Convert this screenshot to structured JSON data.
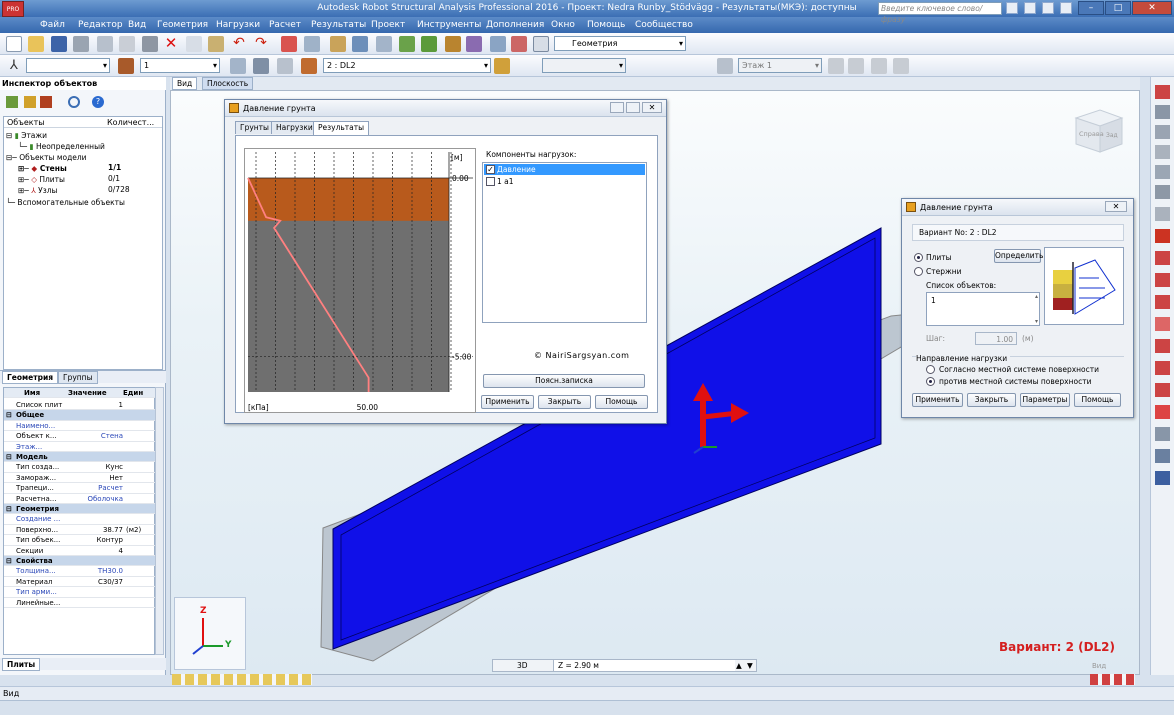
{
  "window": {
    "title": "Autodesk Robot Structural Analysis Professional 2016 - Проект: Nedra Runby_Stödvägg - Результаты(МКЭ): доступны",
    "app_badge": "PRO"
  },
  "menu": [
    "Файл",
    "Редактор",
    "Вид",
    "Геометрия",
    "Нагрузки",
    "Расчет",
    "Результаты",
    "Проект",
    "Инструменты",
    "Дополнения",
    "Окно",
    "Помощь",
    "Сообщество"
  ],
  "search": {
    "placeholder": "Введите ключевое слово/фразу"
  },
  "toolbar1": {
    "layout_combo": "Геометрия"
  },
  "toolbar2": {
    "combo_section": "1",
    "combo_case": "2 : DL2",
    "combo_story": "Этаж 1"
  },
  "inspector": {
    "title": "Инспектор объектов",
    "col_objects": "Объекты",
    "col_count": "Количест...",
    "tree": [
      {
        "label": "Этажи",
        "count": "",
        "indent": 0,
        "bold": false
      },
      {
        "label": "Неопределенный",
        "count": "",
        "indent": 2,
        "bold": false
      },
      {
        "label": "Объекты модели",
        "count": "",
        "indent": 0,
        "bold": false
      },
      {
        "label": "Стены",
        "count": "1/1",
        "indent": 1,
        "bold": true
      },
      {
        "label": "Плиты",
        "count": "0/1",
        "indent": 1,
        "bold": false
      },
      {
        "label": "Узлы",
        "count": "0/728",
        "indent": 1,
        "bold": false
      },
      {
        "label": "Вспомогательные объекты",
        "count": "",
        "indent": 0,
        "bold": false
      }
    ],
    "tabs": [
      "Геометрия",
      "Группы"
    ]
  },
  "props": {
    "header": {
      "name": "Имя",
      "value": "Значение",
      "unit": "Един"
    },
    "rows": [
      {
        "name": "Список плит",
        "value": "1",
        "unit": "",
        "group": false,
        "blue": false
      },
      {
        "name": "Общее",
        "value": "",
        "unit": "",
        "group": true,
        "blue": false
      },
      {
        "name": "Наимено...",
        "value": "",
        "unit": "",
        "group": false,
        "blue": true
      },
      {
        "name": "Объект к...",
        "value": "Стена",
        "unit": "",
        "group": false,
        "blue": false
      },
      {
        "name": "Этаж...",
        "value": "",
        "unit": "",
        "group": false,
        "blue": true
      },
      {
        "name": "Модель",
        "value": "",
        "unit": "",
        "group": true,
        "blue": false
      },
      {
        "name": "Тип созда...",
        "value": "Кунс",
        "unit": "",
        "group": false,
        "blue": false
      },
      {
        "name": "Замораж...",
        "value": "Нет",
        "unit": "",
        "group": false,
        "blue": false
      },
      {
        "name": "Трапеци...",
        "value": "Расчет",
        "unit": "",
        "group": false,
        "blue": false
      },
      {
        "name": "Расчетна...",
        "value": "Оболочка",
        "unit": "",
        "group": false,
        "blue": false
      },
      {
        "name": "Геометрия",
        "value": "",
        "unit": "",
        "group": true,
        "blue": false
      },
      {
        "name": "Создание ...",
        "value": "",
        "unit": "",
        "group": false,
        "blue": true
      },
      {
        "name": "Поверхно...",
        "value": "38.77",
        "unit": "(м2)",
        "group": false,
        "blue": false
      },
      {
        "name": "Тип объек...",
        "value": "Контур",
        "unit": "",
        "group": false,
        "blue": false
      },
      {
        "name": "Секции",
        "value": "4",
        "unit": "",
        "group": false,
        "blue": false
      },
      {
        "name": "Свойства",
        "value": "",
        "unit": "",
        "group": true,
        "blue": false
      },
      {
        "name": "Толщина...",
        "value": "TH30.0",
        "unit": "",
        "group": false,
        "blue": true
      },
      {
        "name": "Материал",
        "value": "C30/37",
        "unit": "",
        "group": false,
        "blue": false
      },
      {
        "name": "Тип арми...",
        "value": "",
        "unit": "",
        "group": false,
        "blue": true
      },
      {
        "name": "Линейные...",
        "value": "",
        "unit": "",
        "group": false,
        "blue": false
      }
    ],
    "bottom_tab": "Плиты"
  },
  "view_tabs": [
    "Вид",
    "Плоскость"
  ],
  "soil_dialog": {
    "title": "Давление грунта",
    "tabs": [
      "Грунты",
      "Нагрузки",
      "Результаты"
    ],
    "active_tab": "Результаты",
    "components_label": "Компоненты нагрузок:",
    "components": [
      {
        "label": "Давление",
        "checked": true
      },
      {
        "label": "1 a1",
        "checked": false
      }
    ],
    "watermark": "© NairiSargsyan.com",
    "note_button": "Поясн.записка",
    "apply": "Применить",
    "close": "Закрыть",
    "help": "Помощь"
  },
  "chart_data": {
    "type": "line",
    "title": "",
    "xlabel": "[кПа]",
    "ylabel": "[м]",
    "y_ticks": [
      "0.00",
      "-5.00"
    ],
    "x_ticks": [
      "50.00"
    ],
    "ylim": [
      -6.0,
      0.0
    ],
    "xlim": [
      0,
      100
    ],
    "series": [
      {
        "x": [
          0,
          9,
          16,
          13,
          60,
          60
        ],
        "y": [
          0.0,
          -1.1,
          -1.2,
          -1.4,
          -5.6,
          -6.0
        ]
      }
    ]
  },
  "load_dialog": {
    "title": "Давление грунта",
    "variant_label": "Вариант No: 2 : DL2",
    "radio_plates": "Плиты",
    "radio_bars": "Стержни",
    "define_button": "Определить",
    "list_label": "Список объектов:",
    "list_value": "1",
    "step_label": "Шаг:",
    "step_value": "1.00",
    "step_unit": "(м)",
    "direction_label": "Направление нагрузки",
    "dir_option1": "Согласно местной системе поверхности",
    "dir_option2": "против местной системы поверхности",
    "apply": "Применить",
    "close": "Закрыть",
    "params": "Параметры",
    "help": "Помощь"
  },
  "viewport": {
    "variant_text": "Вариант: 2 (DL2)",
    "view_label": "Вид",
    "cube_labels": [
      "Справа",
      "Зад"
    ],
    "axis_z": "Z",
    "axis_y": "Y",
    "mode_3d": "3D",
    "z_level": "Z = 2.90 м"
  },
  "statusbar": {
    "text": "Вид"
  },
  "colors": {
    "wall": "#1010e8",
    "soil_top": "#b85a1c",
    "soil_body": "#6f6f6f",
    "pressure_line": "#ff8080",
    "variant": "#d41f1f"
  }
}
